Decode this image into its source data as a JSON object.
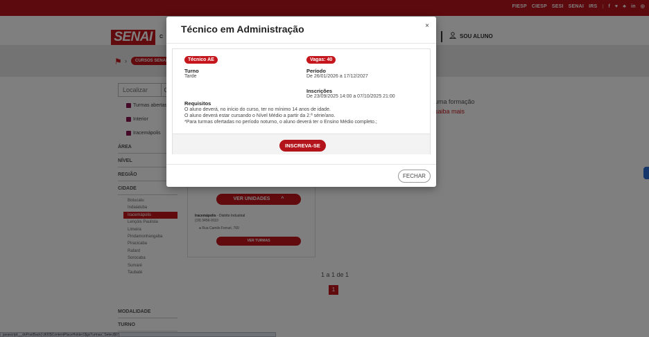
{
  "topbar": {
    "links": [
      "FIESP",
      "CIESP",
      "SESI",
      "SENAI",
      "IRS",
      "f",
      "♥",
      "♣",
      "in",
      "◎"
    ]
  },
  "header": {
    "logo": "SENAI",
    "logo_trail": "C",
    "user_link": "SOU ALUNO"
  },
  "breadcrumb": {
    "home_icon": "home-icon",
    "current": "CURSOS SENAI"
  },
  "sidebar": {
    "search_placeholder": "Localizar",
    "filters": [
      "Turmas abertas",
      "Interior",
      "Iracemápolis"
    ],
    "sections": {
      "area": "ÁREA",
      "nivel": "NÍVEL",
      "regiao": "REGIÃO",
      "cidade": "CIDADE",
      "modalidade": "MODALIDADE",
      "turno": "TURNO"
    },
    "cities": [
      "Botucatu",
      "Indaiatuba",
      "Iracemápolis",
      "Lençóis Paulista",
      "Limeira",
      "Pindamonhangaba",
      "Piracicaba",
      "Rafard",
      "Sorocaba",
      "Sumaré",
      "Taubaté"
    ],
    "active_city": "Iracemápolis"
  },
  "main": {
    "intro_text": "uma formação",
    "saiba_link": "saiba mais",
    "card": {
      "units_button": "VER UNIDADES",
      "unit_name": "Iracemápolis",
      "unit_district": " - Distrito Industrial",
      "unit_phone": "(19) 3456-9110",
      "unit_address": "Rua Camilo Ferrari, 760",
      "classes_button": "VER TURMAS"
    },
    "pagination_text": "1 a 1 de 1",
    "current_page": "1"
  },
  "modal": {
    "title": "Técnico em Administração",
    "close_label": "×",
    "course_badge": "Técnico AE",
    "vagas_badge": "Vagas: 40",
    "turno_label": "Turno",
    "turno_value": "Tarde",
    "periodo_label": "Período",
    "periodo_value": "De 26/01/2026 a 17/12/2027",
    "inscricoes_label": "Inscrições",
    "inscricoes_value": "De 23/09/2025 14:00 a 07/10/2025 21:00",
    "requisitos_label": "Requisitos",
    "requisitos": [
      "O aluno deverá, no início do curso, ter no mínimo 14 anos de idade.",
      "O aluno deverá estar cursando o Nível Médio a partir da 2.ª série/ano.",
      "*Para turmas ofertadas no período noturno, o aluno deverá ter o Ensino Médio completo.;"
    ],
    "subscribe_button": "INSCREVA-SE",
    "close_button": "FECHAR"
  },
  "statusbar": {
    "text": "javascript:__doPostBack('ctl00$ContentPlaceHolder1$gvTurmas','Select$0')"
  },
  "colors": {
    "brand_red": "#c4161c",
    "topbar_red": "#b8141b",
    "overlay": "rgba(0,0,0,0.5)"
  }
}
